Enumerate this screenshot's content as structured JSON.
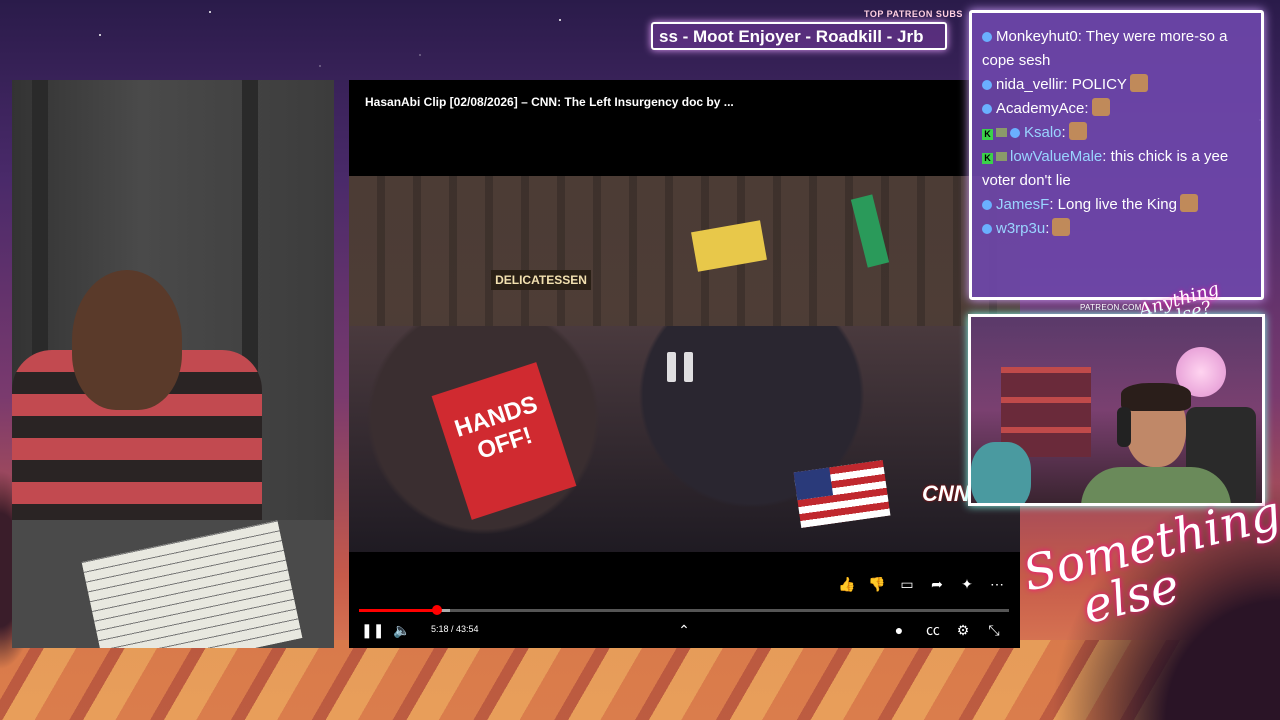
{
  "overlay": {
    "subs_label": "TOP PATREON SUBS",
    "subs_ticker": "ss - Moot Enjoyer - Roadkill - Jrb",
    "patreon_label": "PATREON.COM/",
    "logo_small_line1": "Anything",
    "logo_small_line2": "else?",
    "logo_big_line1": "Something",
    "logo_big_line2": "else"
  },
  "player": {
    "title": "HasanAbi Clip [02/08/2026] – CNN: The Left Insurgency doc by ...",
    "time": "5:18 / 43:54",
    "progress": 0.1207,
    "buffered": 0.14,
    "scene": {
      "deli_sign": "DELICATESSEN",
      "protest_sign": "HANDS OFF!",
      "network_logo": "CNN"
    }
  },
  "chat": {
    "messages": [
      {
        "user": "Monkeyhut0",
        "color": "#ffffff",
        "text": ": They were more-so a cope sesh",
        "badges": [
          "dot"
        ],
        "emotes": 0
      },
      {
        "user": "nida_vellir",
        "color": "#ffffff",
        "text": ": POLICY",
        "badges": [
          "dot"
        ],
        "emotes": 1
      },
      {
        "user": "AcademyAce",
        "color": "#ffffff",
        "text": ":",
        "badges": [
          "dot"
        ],
        "emotes": 1
      },
      {
        "user": "Ksalo",
        "color": "#9ad4ff",
        "text": ":",
        "badges": [
          "k",
          "sq",
          "dot"
        ],
        "emotes": 1
      },
      {
        "user": "lowValueMale",
        "color": "#9ad4ff",
        "text": ": this chick is a yee voter don't lie",
        "badges": [
          "k",
          "sq"
        ],
        "emotes": 0
      },
      {
        "user": "JamesF",
        "color": "#9ad4ff",
        "text": ": Long live the King",
        "badges": [
          "dot"
        ],
        "emotes": 1
      },
      {
        "user": "w3rp3u",
        "color": "#9ad4ff",
        "text": ":",
        "badges": [
          "dot"
        ],
        "emotes": 1
      }
    ]
  }
}
